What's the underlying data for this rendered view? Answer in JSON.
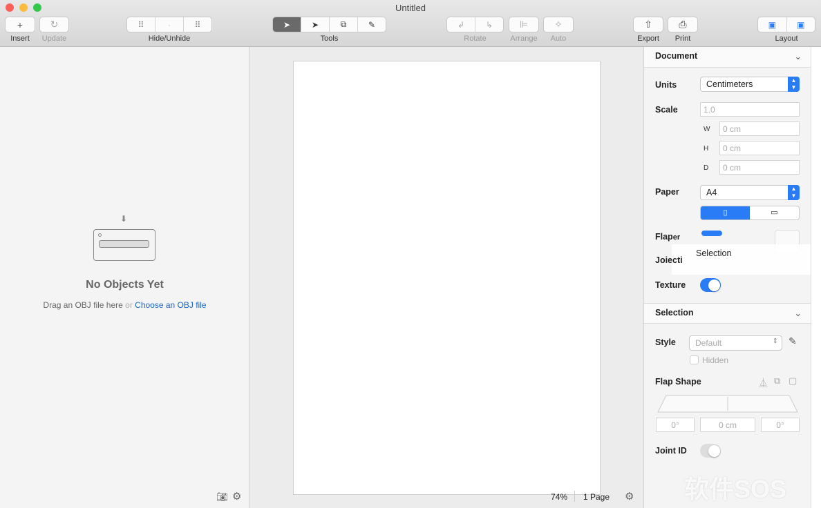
{
  "window": {
    "title": "Untitled"
  },
  "toolbar": {
    "insert": "Insert",
    "update": "Update",
    "hide_unhide": "Hide/Unhide",
    "tools": "Tools",
    "rotate": "Rotate",
    "arrange": "Arrange",
    "auto": "Auto",
    "export": "Export",
    "print": "Print",
    "layout": "Layout"
  },
  "left_panel": {
    "empty_title": "No Objects Yet",
    "hint": "Drag an OBJ file here",
    "or": "or",
    "link": "Choose an OBJ file"
  },
  "canvas": {
    "zoom": "74%",
    "pages": "1 Page"
  },
  "document": {
    "header": "Document",
    "units_label": "Units",
    "units_value": "Centimeters",
    "scale_label": "Scale",
    "scale_value": "1.0",
    "w_label": "W",
    "w_value": "0 cm",
    "h_label": "H",
    "h_value": "0 cm",
    "d_label": "D",
    "d_value": "0 cm",
    "paper_label": "Paper",
    "paper_value": "A4",
    "flaps_label": "Flap",
    "flaps_overlap": "er",
    "joints_label": "Joiecti",
    "transition_label": "Selection",
    "texture_label": "Texture",
    "texture_on": true
  },
  "selection": {
    "header": "Selection",
    "style_label": "Style",
    "style_value": "Default",
    "hidden_label": "Hidden",
    "flap_shape_label": "Flap Shape",
    "angle_left": "0°",
    "length": "0 cm",
    "angle_right": "0°",
    "joint_id_label": "Joint ID",
    "joint_id_on": false
  },
  "watermark": "软件SOS",
  "colors": {
    "accent": "#2a7cf6",
    "link": "#1a64c8"
  }
}
